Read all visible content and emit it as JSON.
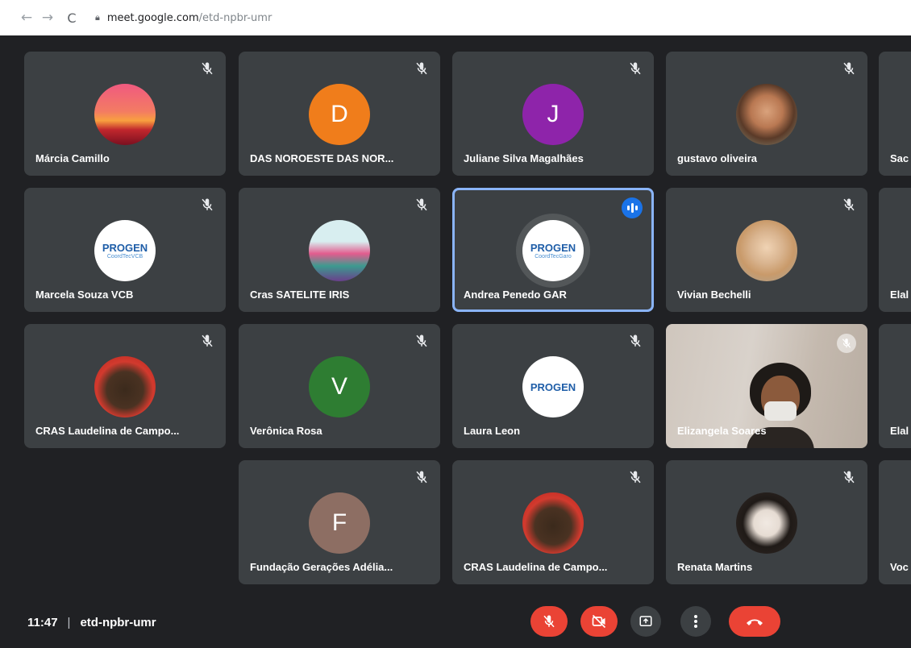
{
  "browser": {
    "url_host": "meet.google.com",
    "url_path": "/etd-npbr-umr"
  },
  "colors": {
    "tile_bg": "#3c4043",
    "active_border": "#8ab4f8",
    "speaking_badge": "#1a73e8",
    "end_call": "#ea4335",
    "letter_D": "#f07d1b",
    "letter_J": "#8e24aa",
    "letter_V": "#2e7d32",
    "letter_F": "#8d6e63"
  },
  "participants": [
    {
      "name": "Márcia Camillo",
      "avatar": "photo-sunset"
    },
    {
      "name": "DAS NOROESTE DAS NOR...",
      "avatar": "letter",
      "letter": "D"
    },
    {
      "name": "Juliane Silva Magalhães",
      "avatar": "letter",
      "letter": "J"
    },
    {
      "name": "gustavo oliveira",
      "avatar": "photo-person"
    },
    {
      "name": "Sac",
      "avatar": "none"
    },
    {
      "name": "Marcela Souza VCB",
      "avatar": "logo-progen",
      "logo_text": "PROGEN",
      "logo_sub": "CoordTecVCB"
    },
    {
      "name": "Cras SATELITE IRIS",
      "avatar": "photo-illustration"
    },
    {
      "name": "Andrea Penedo GAR",
      "avatar": "logo-progen",
      "logo_text": "PROGEN",
      "logo_sub": "CoordTecGaro",
      "speaking": true
    },
    {
      "name": "Vivian Bechelli",
      "avatar": "photo-person"
    },
    {
      "name": "Elal",
      "avatar": "none"
    },
    {
      "name": "CRAS Laudelina de Campo...",
      "avatar": "photo-illustration"
    },
    {
      "name": "Verônica Rosa",
      "avatar": "letter",
      "letter": "V"
    },
    {
      "name": "Laura Leon",
      "avatar": "logo-progen",
      "logo_text": "PROGEN"
    },
    {
      "name": "Elizangela Soares",
      "avatar": "video-feed"
    },
    {
      "name": "Elal",
      "avatar": "none"
    },
    {
      "name": "Fundação Gerações Adélia...",
      "avatar": "letter",
      "letter": "F"
    },
    {
      "name": "CRAS Laudelina de Campo...",
      "avatar": "photo-illustration"
    },
    {
      "name": "Renata Martins",
      "avatar": "photo-person"
    },
    {
      "name": "Voc",
      "avatar": "none"
    }
  ],
  "bottom_bar": {
    "time": "11:47",
    "separator": "|",
    "meeting_code": "etd-npbr-umr",
    "controls": [
      "mic-off-icon",
      "camera-off-icon",
      "present-screen-icon",
      "more-options-icon",
      "end-call-icon"
    ]
  }
}
